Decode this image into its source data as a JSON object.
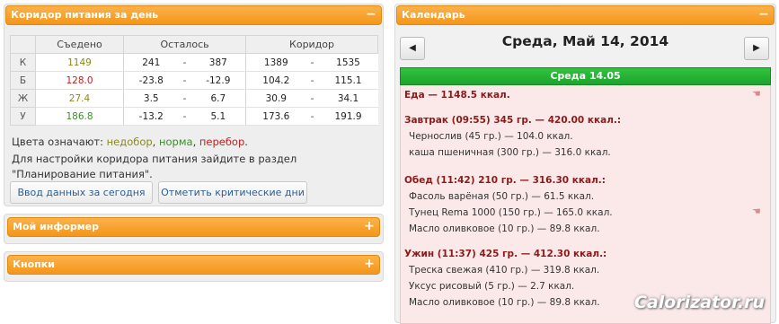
{
  "corridor": {
    "title": "Коридор питания за день",
    "toggle": "−",
    "headers": {
      "eaten": "Съедено",
      "left": "Осталось",
      "corridor": "Коридор"
    },
    "rows": [
      {
        "label": "К",
        "eaten": "1149",
        "eaten_class": "c-under",
        "left_a": "241",
        "left_b": "387",
        "cor_a": "1389",
        "cor_b": "1535"
      },
      {
        "label": "Б",
        "eaten": "128.0",
        "eaten_class": "c-over",
        "left_a": "-23.8",
        "left_b": "-12.9",
        "cor_a": "104.2",
        "cor_b": "115.1"
      },
      {
        "label": "Ж",
        "eaten": "27.4",
        "eaten_class": "c-under",
        "left_a": "3.5",
        "left_b": "6.7",
        "cor_a": "30.9",
        "cor_b": "34.1"
      },
      {
        "label": "У",
        "eaten": "186.8",
        "eaten_class": "c-norm",
        "left_a": "-13.2",
        "left_b": "5.1",
        "cor_a": "173.6",
        "cor_b": "191.9"
      }
    ],
    "sep": "-",
    "legend": {
      "prefix": "Цвета означают:",
      "under": "недобор",
      "norm": "норма",
      "over": "перебор",
      "comma": ",",
      "end": "."
    },
    "hint": "Для настройки коридора питания зайдите в раздел \"Планирование питания\".",
    "btn_today": "Ввод данных за сегодня",
    "btn_critical": "Отметить критические дни",
    "colors": {
      "under": "#8a8a1f",
      "norm": "#3f8c2c",
      "over": "#c0201f"
    }
  },
  "informer": {
    "title": "Мой информер",
    "toggle": "+"
  },
  "buttons_panel": {
    "title": "Кнопки",
    "toggle": "+"
  },
  "calendar": {
    "title": "Календарь",
    "toggle": "−",
    "nav_prev": "◀",
    "nav_next": "▶",
    "date_title": "Среда, Май 14, 2014",
    "day_label": "Среда 14.05",
    "total": "Еда — 1148.5 ккал.",
    "meals": [
      {
        "heading": "Завтрак (09:55) 345 гр. — 420.00 ккал.:",
        "items": [
          "Чернослив (45 гр.) — 104.0 ккал.",
          "каша пшеничная (300 гр.) — 316.0 ккал."
        ]
      },
      {
        "heading": "Обед (11:42) 210 гр. — 316.30 ккал.:",
        "items": [
          "Фасоль варёная (50 гр.) — 61.5 ккал.",
          "Тунец Rema 1000 (150 гр.) — 165.0 ккал.",
          "Масло оливковое (10 гр.) — 89.8 ккал."
        ]
      },
      {
        "heading": "Ужин (11:37) 425 гр. — 412.30 ккал.:",
        "items": [
          "Треска свежая (410 гр.) — 319.8 ккал.",
          "Уксус рисовый (5 гр.) — 2.7 ккал.",
          "Масло оливковое (10 гр.) — 89.8 ккал."
        ]
      }
    ]
  },
  "watermark": "Calorizator.ru"
}
